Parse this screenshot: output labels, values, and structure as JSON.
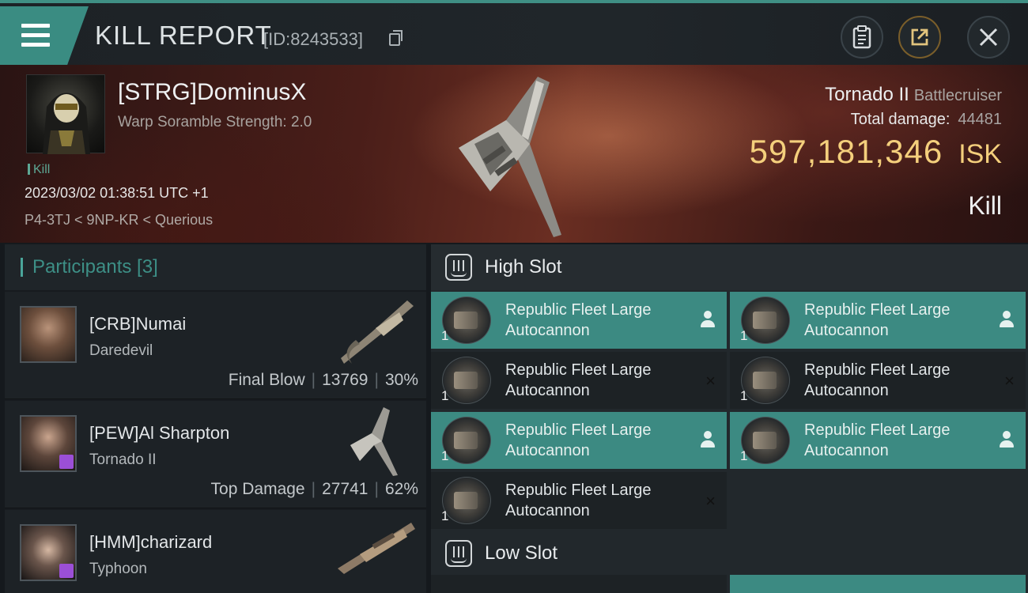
{
  "header": {
    "title": "KILL REPORT",
    "kill_id": "[ID:8243533]",
    "icons": [
      "menu-icon",
      "copy-icon",
      "clipboard-icon",
      "share-icon",
      "close-icon"
    ]
  },
  "victim": {
    "name": "[STRG]DominusX",
    "scramble": "Warp Soramble Strength: 2.0",
    "tag": "Kill",
    "time": "2023/03/02 01:38:51 UTC +1",
    "location": "P4-3TJ < 9NP-KR < Querious",
    "ship": "Tornado II",
    "ship_class": "Battlecruiser",
    "total_damage_label": "Total damage:",
    "total_damage": "44481",
    "isk": "597,181,346",
    "isk_unit": "ISK",
    "result": "Kill"
  },
  "participants": {
    "title": "Participants [3]",
    "rows": [
      {
        "name": "[CRB]Numai",
        "ship": "Daredevil",
        "label": "Final Blow",
        "damage": "13769",
        "percent": "30%"
      },
      {
        "name": "[PEW]Al Sharpton",
        "ship": "Tornado II",
        "label": "Top Damage",
        "damage": "27741",
        "percent": "62%"
      },
      {
        "name": "[HMM]charizard",
        "ship": "Typhoon",
        "label": "",
        "damage": "",
        "percent": ""
      }
    ]
  },
  "fitting": {
    "high_slot_title": "High Slot",
    "low_slot_title": "Low Slot",
    "high_modules": [
      {
        "line1": "Republic Fleet Large",
        "line2": "Autocannon",
        "qty": "1",
        "status": "person-icon"
      },
      {
        "line1": "Republic Fleet Large",
        "line2": "Autocannon",
        "qty": "1",
        "status": "person-icon"
      },
      {
        "line1": "Republic Fleet Large",
        "line2": "Autocannon",
        "qty": "1",
        "status": "×"
      },
      {
        "line1": "Republic Fleet Large",
        "line2": "Autocannon",
        "qty": "1",
        "status": "×"
      },
      {
        "line1": "Republic Fleet Large",
        "line2": "Autocannon",
        "qty": "1",
        "status": "person-icon"
      },
      {
        "line1": "Republic Fleet Large",
        "line2": "Autocannon",
        "qty": "1",
        "status": "person-icon"
      },
      {
        "line1": "Republic Fleet Large",
        "line2": "Autocannon",
        "qty": "1",
        "status": "×"
      }
    ]
  },
  "colors": {
    "accent": "#3c8a82",
    "isk": "#f4cf7c",
    "implant_badge": "#9b4fd6"
  }
}
